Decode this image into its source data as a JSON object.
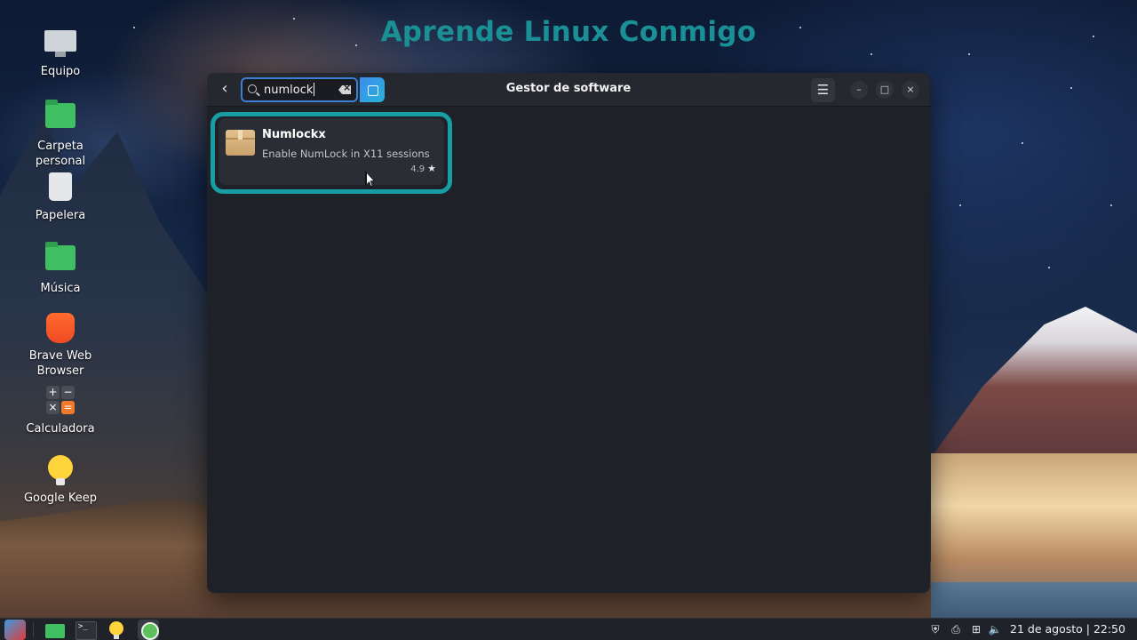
{
  "banner": {
    "title": "Aprende Linux Conmigo"
  },
  "desktop": {
    "icons": [
      {
        "label": "Equipo",
        "icon": "computer-icon"
      },
      {
        "label": "Carpeta personal",
        "icon": "home-folder-icon"
      },
      {
        "label": "Papelera",
        "icon": "trash-icon"
      },
      {
        "label": "Música",
        "icon": "music-folder-icon"
      },
      {
        "label": "Brave Web Browser",
        "icon": "brave-browser-icon"
      },
      {
        "label": "Calculadora",
        "icon": "calculator-icon"
      },
      {
        "label": "Google Keep",
        "icon": "google-keep-icon"
      }
    ]
  },
  "window": {
    "title": "Gestor de software",
    "back_icon": "‹",
    "menu_icon": "☰",
    "minimize_icon": "–",
    "maximize_icon": "□",
    "close_icon": "×",
    "search": {
      "value": "numlock"
    },
    "results": [
      {
        "name": "Numlockx",
        "description": "Enable NumLock in X11 sessions",
        "rating": "4.9",
        "star": "★"
      }
    ]
  },
  "taskbar": {
    "items": [
      "start-menu-icon",
      "file-manager-icon",
      "terminal-icon",
      "google-keep-icon",
      "software-manager-icon"
    ],
    "tray": [
      "shield-icon",
      "printer-icon",
      "network-icon",
      "volume-icon"
    ],
    "tray_glyphs": {
      "shield": "⛨",
      "printer": "⎙",
      "network": "⊞",
      "volume": "🔈"
    },
    "clock": "21 de agosto | 22:50"
  },
  "colors": {
    "banner": "#1a8f96",
    "highlight": "#179ea4",
    "accent": "#3c7fd4"
  }
}
